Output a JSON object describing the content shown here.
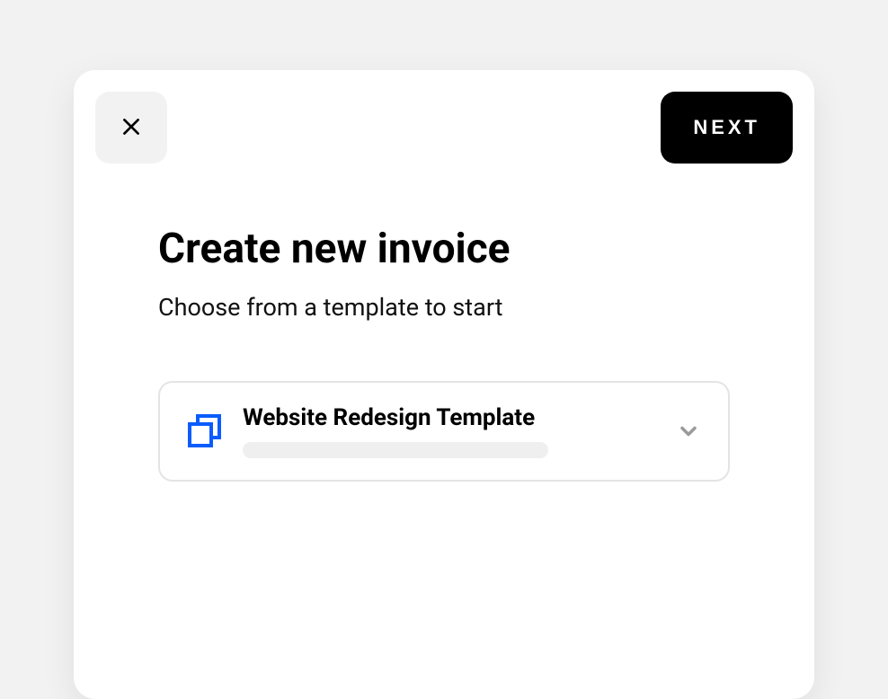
{
  "header": {
    "next_label": "NEXT"
  },
  "main": {
    "title": "Create new invoice",
    "subtitle": "Choose from a template to start"
  },
  "template_select": {
    "selected": "Website Redesign Template"
  },
  "colors": {
    "accent": "#0b5cff",
    "bg": "#f2f2f2",
    "border": "#e4e4e4"
  }
}
